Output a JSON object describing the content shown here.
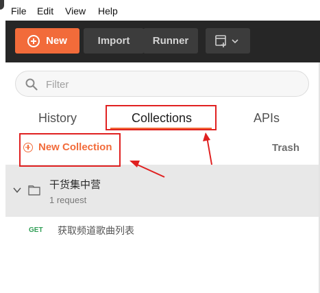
{
  "menu": {
    "file": "File",
    "edit": "Edit",
    "view": "View",
    "help": "Help"
  },
  "toolbar": {
    "new_label": "New",
    "import_label": "Import",
    "runner_label": "Runner"
  },
  "search": {
    "placeholder": "Filter",
    "value": ""
  },
  "tabs": [
    {
      "label": "History"
    },
    {
      "label": "Collections",
      "active": true
    },
    {
      "label": "APIs"
    }
  ],
  "actions": {
    "new_collection_label": "New Collection",
    "trash_label": "Trash"
  },
  "collection": {
    "name": "干货集中营",
    "count": "1 request"
  },
  "request": {
    "method": "GET",
    "name": "获取频道歌曲列表"
  },
  "colors": {
    "accent": "#f26b3a",
    "toolbar_bg": "#262626",
    "annotation_red": "#e02020",
    "get_method": "#2f9e55"
  },
  "icons": {
    "search": "search-icon",
    "plus": "plus-circle-icon",
    "new_window": "new-window-icon",
    "chevron": "chevron-down-icon",
    "folder": "folder-icon"
  }
}
